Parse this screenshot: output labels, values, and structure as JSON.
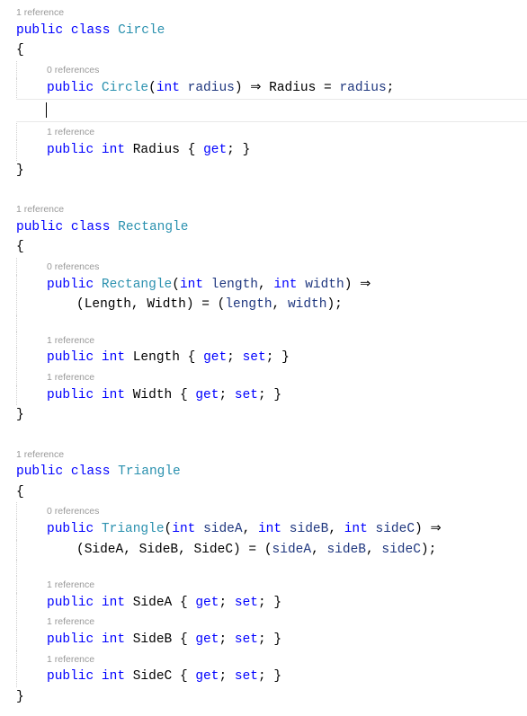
{
  "circle": {
    "classRefs": "1 reference",
    "kw_public": "public",
    "kw_class": "class",
    "className": "Circle",
    "openBrace": "{",
    "ctorRefs": "0 references",
    "ctorLine_p1": "public",
    "ctorLine_type": "Circle",
    "ctorLine_p2": "(",
    "ctorLine_intKw": "int",
    "ctorLine_param": "radius",
    "ctorLine_p3": ") ⇒ Radius = ",
    "ctorLine_paramRef": "radius",
    "ctorLine_p4": ";",
    "radiusRefs": "1 reference",
    "radius_p1": "public",
    "radius_intKw": "int",
    "radius_name": "Radius",
    "radius_p2": "{ ",
    "radius_get": "get",
    "radius_p3": "; }",
    "closeBrace": "}"
  },
  "rectangle": {
    "classRefs": "1 reference",
    "kw_public": "public",
    "kw_class": "class",
    "className": "Rectangle",
    "openBrace": "{",
    "ctorRefs": "0 references",
    "ctor_p1": "public",
    "ctor_type": "Rectangle",
    "ctor_p2": "(",
    "ctor_intKw1": "int",
    "ctor_param1": "length",
    "ctor_comma1": ", ",
    "ctor_intKw2": "int",
    "ctor_param2": "width",
    "ctor_p3": ") ⇒",
    "ctorBody_p1": "(Length, Width) = (",
    "ctorBody_param1": "length",
    "ctorBody_comma": ", ",
    "ctorBody_param2": "width",
    "ctorBody_p2": ");",
    "lengthRefs": "1 reference",
    "length_p1": "public",
    "length_intKw": "int",
    "length_name": "Length",
    "length_p2": "{ ",
    "length_get": "get",
    "length_semi1": "; ",
    "length_set": "set",
    "length_p3": "; }",
    "widthRefs": "1 reference",
    "width_p1": "public",
    "width_intKw": "int",
    "width_name": "Width",
    "width_p2": "{ ",
    "width_get": "get",
    "width_semi1": "; ",
    "width_set": "set",
    "width_p3": "; }",
    "closeBrace": "}"
  },
  "triangle": {
    "classRefs": "1 reference",
    "kw_public": "public",
    "kw_class": "class",
    "className": "Triangle",
    "openBrace": "{",
    "ctorRefs": "0 references",
    "ctor_p1": "public",
    "ctor_type": "Triangle",
    "ctor_p2": "(",
    "ctor_intKw1": "int",
    "ctor_param1": "sideA",
    "ctor_comma1": ", ",
    "ctor_intKw2": "int",
    "ctor_param2": "sideB",
    "ctor_comma2": ", ",
    "ctor_intKw3": "int",
    "ctor_param3": "sideC",
    "ctor_p3": ") ⇒",
    "ctorBody_p1": "(SideA, SideB, SideC) = (",
    "ctorBody_param1": "sideA",
    "ctorBody_comma1": ", ",
    "ctorBody_param2": "sideB",
    "ctorBody_comma2": ", ",
    "ctorBody_param3": "sideC",
    "ctorBody_p2": ");",
    "sideARefs": "1 reference",
    "sideA_p1": "public",
    "sideA_intKw": "int",
    "sideA_name": "SideA",
    "sideA_p2": "{ ",
    "sideA_get": "get",
    "sideA_semi1": "; ",
    "sideA_set": "set",
    "sideA_p3": "; }",
    "sideBRefs": "1 reference",
    "sideB_p1": "public",
    "sideB_intKw": "int",
    "sideB_name": "SideB",
    "sideB_p2": "{ ",
    "sideB_get": "get",
    "sideB_semi1": "; ",
    "sideB_set": "set",
    "sideB_p3": "; }",
    "sideCRefs": "1 reference",
    "sideC_p1": "public",
    "sideC_intKw": "int",
    "sideC_name": "SideC",
    "sideC_p2": "{ ",
    "sideC_get": "get",
    "sideC_semi1": "; ",
    "sideC_set": "set",
    "sideC_p3": "; }",
    "closeBrace": "}"
  }
}
